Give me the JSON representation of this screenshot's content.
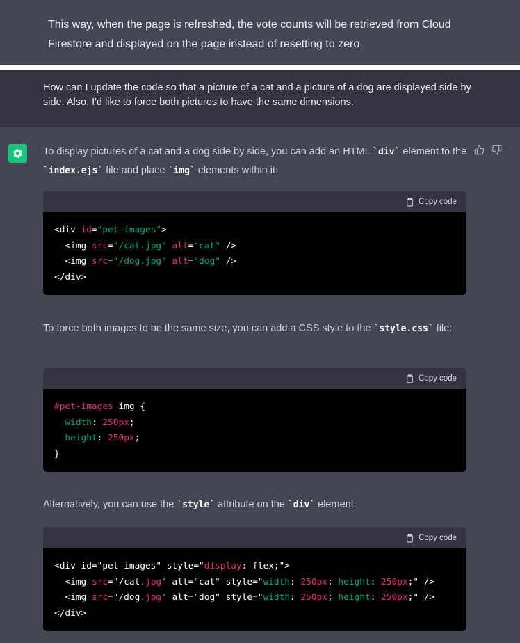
{
  "previous_message": {
    "text": "This way, when the page is refreshed, the vote counts will be retrieved from Cloud Firestore and displayed on the page instead of resetting to zero."
  },
  "user_message": {
    "text": "How can I update the code so that a picture of a cat and a picture of a dog are displayed side by side. Also, I'd like to force both pictures to have the same dimensions."
  },
  "assistant": {
    "avatar_icon": "openai-logo-icon",
    "avatar_color": "#19c37d",
    "feedback": {
      "like_icon": "thumbs-up-icon",
      "dislike_icon": "thumbs-down-icon"
    },
    "para1": {
      "pre": "To display pictures of a cat and a dog side by side, you can add an HTML ",
      "code1": "`div`",
      "mid": " element to the ",
      "code2": "`index.ejs`",
      "mid2": " file and place ",
      "code3": "`img`",
      "post": " elements within it:"
    },
    "code1": {
      "copy_label": "Copy code",
      "lines": [
        [
          {
            "t": "<div ",
            "c": "plain"
          },
          {
            "t": "id",
            "c": "attr"
          },
          {
            "t": "=",
            "c": "plain"
          },
          {
            "t": "\"pet-images\"",
            "c": "str"
          },
          {
            "t": ">",
            "c": "plain"
          }
        ],
        [
          {
            "t": "  <img ",
            "c": "plain"
          },
          {
            "t": "src",
            "c": "attr"
          },
          {
            "t": "=",
            "c": "plain"
          },
          {
            "t": "\"/cat.jpg\"",
            "c": "str"
          },
          {
            "t": " ",
            "c": "plain"
          },
          {
            "t": "alt",
            "c": "attr"
          },
          {
            "t": "=",
            "c": "plain"
          },
          {
            "t": "\"cat\"",
            "c": "str"
          },
          {
            "t": " />",
            "c": "plain"
          }
        ],
        [
          {
            "t": "  <img ",
            "c": "plain"
          },
          {
            "t": "src",
            "c": "attr"
          },
          {
            "t": "=",
            "c": "plain"
          },
          {
            "t": "\"/dog.jpg\"",
            "c": "str"
          },
          {
            "t": " ",
            "c": "plain"
          },
          {
            "t": "alt",
            "c": "attr"
          },
          {
            "t": "=",
            "c": "plain"
          },
          {
            "t": "\"dog\"",
            "c": "str"
          },
          {
            "t": " />",
            "c": "plain"
          }
        ],
        [
          {
            "t": "</div>",
            "c": "plain"
          }
        ]
      ]
    },
    "para2": {
      "pre": "To force both images to be the same size, you can add a CSS style to the ",
      "code1": "`style.css`",
      "post": " file:"
    },
    "code2": {
      "copy_label": "Copy code",
      "lines": [
        [
          {
            "t": "#pet-images",
            "c": "sel"
          },
          {
            "t": " img {",
            "c": "plain"
          }
        ],
        [
          {
            "t": "  ",
            "c": "plain"
          },
          {
            "t": "width",
            "c": "prop"
          },
          {
            "t": ": ",
            "c": "plain"
          },
          {
            "t": "250px",
            "c": "val"
          },
          {
            "t": ";",
            "c": "plain"
          }
        ],
        [
          {
            "t": "  ",
            "c": "plain"
          },
          {
            "t": "height",
            "c": "prop"
          },
          {
            "t": ": ",
            "c": "plain"
          },
          {
            "t": "250px",
            "c": "val"
          },
          {
            "t": ";",
            "c": "plain"
          }
        ],
        [
          {
            "t": "}",
            "c": "plain"
          }
        ]
      ]
    },
    "para3": {
      "pre": "Alternatively, you can use the ",
      "code1": "`style`",
      "mid": " attribute on the ",
      "code2": "`div`",
      "post": " element:"
    },
    "code3": {
      "copy_label": "Copy code",
      "lines": [
        [
          {
            "t": "<div id=\"pet-images\" style=\"",
            "c": "plain"
          },
          {
            "t": "display",
            "c": "attr"
          },
          {
            "t": ": flex;\">",
            "c": "plain"
          }
        ],
        [
          {
            "t": "  <img ",
            "c": "plain"
          },
          {
            "t": "src",
            "c": "attr"
          },
          {
            "t": "=\"/cat",
            "c": "plain"
          },
          {
            "t": ".jpg",
            "c": "attr"
          },
          {
            "t": "\" alt=\"cat\" style=\"",
            "c": "plain"
          },
          {
            "t": "width",
            "c": "prop"
          },
          {
            "t": ": ",
            "c": "plain"
          },
          {
            "t": "250px",
            "c": "val"
          },
          {
            "t": "; ",
            "c": "plain"
          },
          {
            "t": "height",
            "c": "prop"
          },
          {
            "t": ": ",
            "c": "plain"
          },
          {
            "t": "250px",
            "c": "val"
          },
          {
            "t": ";\" />",
            "c": "plain"
          }
        ],
        [
          {
            "t": "  <img ",
            "c": "plain"
          },
          {
            "t": "src",
            "c": "attr"
          },
          {
            "t": "=\"/dog",
            "c": "plain"
          },
          {
            "t": ".jpg",
            "c": "attr"
          },
          {
            "t": "\" alt=\"dog\" style=\"",
            "c": "plain"
          },
          {
            "t": "width",
            "c": "prop"
          },
          {
            "t": ": ",
            "c": "plain"
          },
          {
            "t": "250px",
            "c": "val"
          },
          {
            "t": "; ",
            "c": "plain"
          },
          {
            "t": "height",
            "c": "prop"
          },
          {
            "t": ": ",
            "c": "plain"
          },
          {
            "t": "250px",
            "c": "val"
          },
          {
            "t": ";\" />",
            "c": "plain"
          }
        ],
        [
          {
            "t": "</div>",
            "c": "plain"
          }
        ]
      ]
    }
  }
}
